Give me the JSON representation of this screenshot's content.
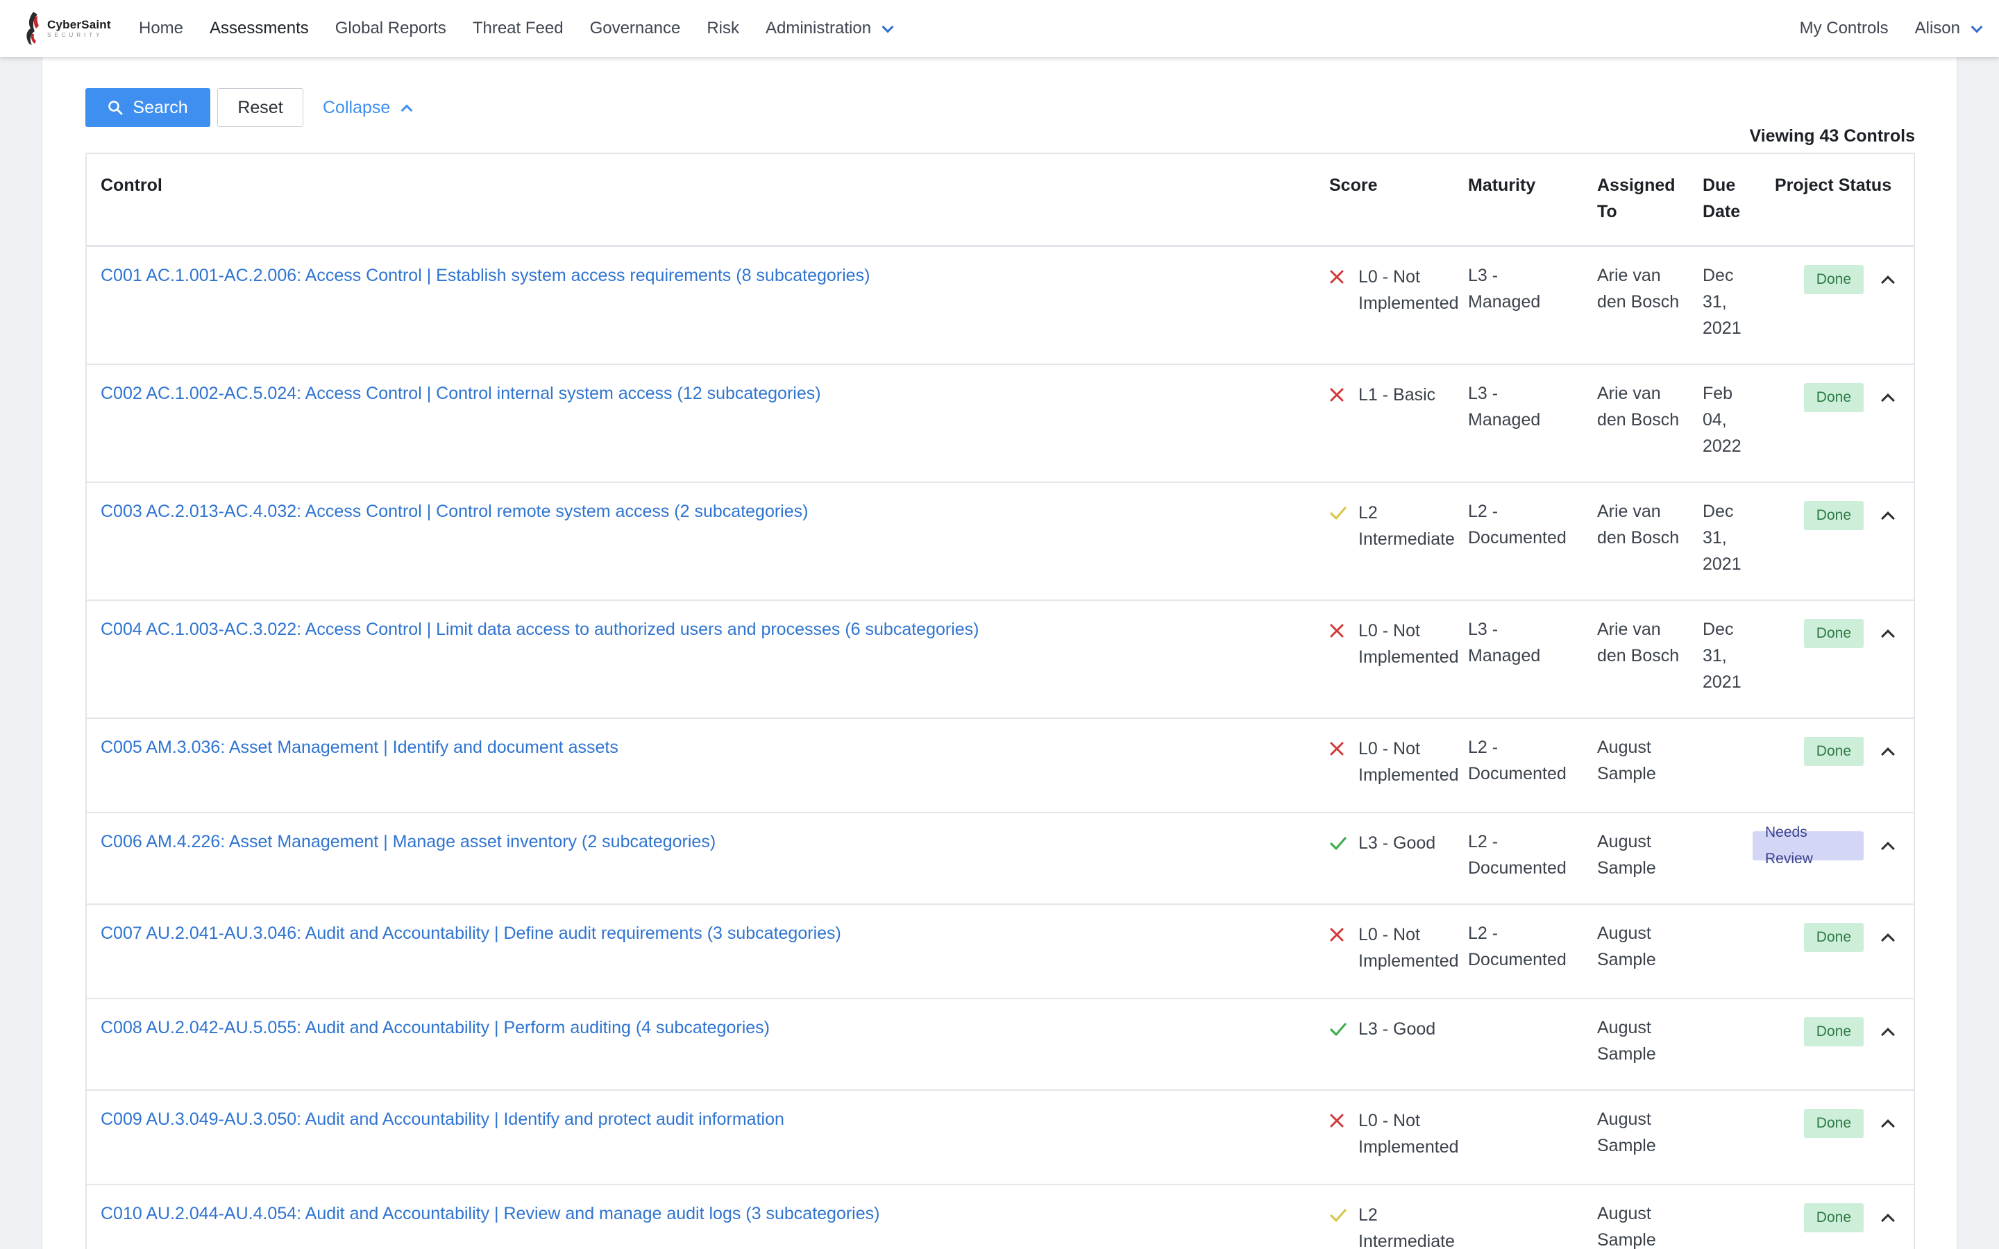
{
  "brand": {
    "name": "CyberSaint",
    "sub": "SECURITY"
  },
  "nav": {
    "links": [
      "Home",
      "Assessments",
      "Global Reports",
      "Threat Feed",
      "Governance",
      "Risk",
      "Administration"
    ],
    "right": [
      "My Controls",
      "Alison"
    ]
  },
  "toolbar": {
    "search_label": "Search",
    "reset_label": "Reset",
    "collapse_label": "Collapse"
  },
  "viewing": "Viewing 43 Controls",
  "table": {
    "headers": {
      "control": "Control",
      "score": "Score",
      "maturity": "Maturity",
      "assigned_1": "Assigned",
      "assigned_2": "To",
      "due_1": "Due",
      "due_2": "Date",
      "status": "Project Status"
    },
    "rows": [
      {
        "control": "C001 AC.1.001-AC.2.006: Access Control | Establish system access requirements (8 subcategories)",
        "score_icon": "x",
        "score_1": "L0 - Not",
        "score_2": "Implemented",
        "maturity_1": "L3 -",
        "maturity_2": "Managed",
        "assigned_1": "Arie van",
        "assigned_2": "den Bosch",
        "due_1": "Dec",
        "due_2": "31,",
        "due_3": "2021",
        "status": "Done"
      },
      {
        "control": "C002 AC.1.002-AC.5.024: Access Control | Control internal system access (12 subcategories)",
        "score_icon": "x",
        "score_1": "L1 - Basic",
        "score_2": "",
        "maturity_1": "L3 -",
        "maturity_2": "Managed",
        "assigned_1": "Arie van",
        "assigned_2": "den Bosch",
        "due_1": "Feb",
        "due_2": "04,",
        "due_3": "2022",
        "status": "Done"
      },
      {
        "control": "C003 AC.2.013-AC.4.032: Access Control | Control remote system access (2 subcategories)",
        "score_icon": "check-yellow",
        "score_1": "L2",
        "score_2": "Intermediate",
        "maturity_1": "L2 -",
        "maturity_2": "Documented",
        "assigned_1": "Arie van",
        "assigned_2": "den Bosch",
        "due_1": "Dec",
        "due_2": "31,",
        "due_3": "2021",
        "status": "Done"
      },
      {
        "control": "C004 AC.1.003-AC.3.022: Access Control | Limit data access to authorized users and processes (6 subcategories)",
        "score_icon": "x",
        "score_1": "L0 - Not",
        "score_2": "Implemented",
        "maturity_1": "L3 -",
        "maturity_2": "Managed",
        "assigned_1": "Arie van",
        "assigned_2": "den Bosch",
        "due_1": "Dec",
        "due_2": "31,",
        "due_3": "2021",
        "status": "Done"
      },
      {
        "control": "C005 AM.3.036: Asset Management | Identify and document assets",
        "score_icon": "x",
        "score_1": "L0 - Not",
        "score_2": "Implemented",
        "maturity_1": "L2 -",
        "maturity_2": "Documented",
        "assigned_1": "August",
        "assigned_2": "Sample",
        "due_1": "",
        "due_2": "",
        "due_3": "",
        "status": "Done"
      },
      {
        "control": "C006 AM.4.226: Asset Management | Manage asset inventory (2 subcategories)",
        "score_icon": "check-green",
        "score_1": "L3 - Good",
        "score_2": "",
        "maturity_1": "L2 -",
        "maturity_2": "Documented",
        "assigned_1": "August",
        "assigned_2": "Sample",
        "due_1": "",
        "due_2": "",
        "due_3": "",
        "status": "Needs Review"
      },
      {
        "control": "C007 AU.2.041-AU.3.046: Audit and Accountability | Define audit requirements (3 subcategories)",
        "score_icon": "x",
        "score_1": "L0 - Not",
        "score_2": "Implemented",
        "maturity_1": "L2 -",
        "maturity_2": "Documented",
        "assigned_1": "August",
        "assigned_2": "Sample",
        "due_1": "",
        "due_2": "",
        "due_3": "",
        "status": "Done"
      },
      {
        "control": "C008 AU.2.042-AU.5.055: Audit and Accountability | Perform auditing (4 subcategories)",
        "score_icon": "check-green",
        "score_1": "L3 - Good",
        "score_2": "",
        "maturity_1": "",
        "maturity_2": "",
        "assigned_1": "August",
        "assigned_2": "Sample",
        "due_1": "",
        "due_2": "",
        "due_3": "",
        "status": "Done"
      },
      {
        "control": "C009 AU.3.049-AU.3.050: Audit and Accountability | Identify and protect audit information",
        "score_icon": "x",
        "score_1": "L0 - Not",
        "score_2": "Implemented",
        "maturity_1": "",
        "maturity_2": "",
        "assigned_1": "August",
        "assigned_2": "Sample",
        "due_1": "",
        "due_2": "",
        "due_3": "",
        "status": "Done"
      },
      {
        "control": "C010 AU.2.044-AU.4.054: Audit and Accountability | Review and manage audit logs (3 subcategories)",
        "score_icon": "check-yellow",
        "score_1": "L2",
        "score_2": "Intermediate",
        "maturity_1": "",
        "maturity_2": "",
        "assigned_1": "August",
        "assigned_2": "Sample",
        "due_1": "",
        "due_2": "",
        "due_3": "",
        "status": "Done"
      }
    ]
  },
  "colors": {
    "accent": "#3f8ff0",
    "link": "#2f74d0",
    "x_icon": "#d0383a",
    "check_green": "#3fae4f",
    "check_yellow": "#d7c74a",
    "done_bg": "#cdeed8",
    "review_bg": "#d3d6f5"
  }
}
